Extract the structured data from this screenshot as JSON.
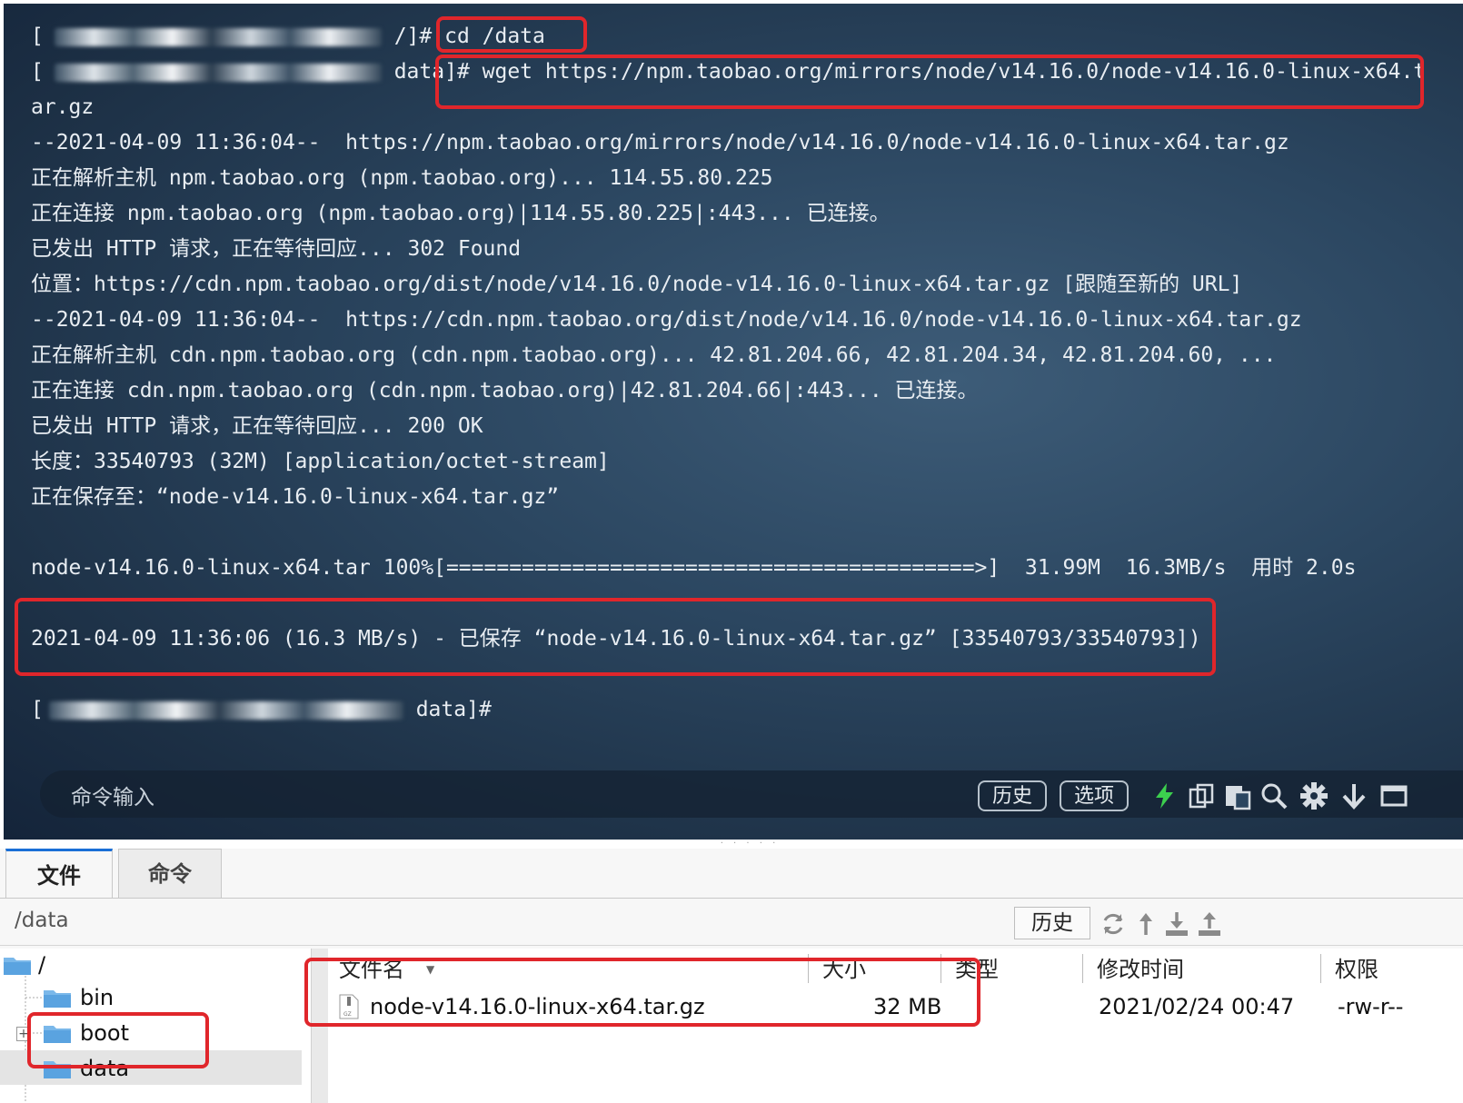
{
  "terminal": {
    "prompt1_suffix": " /]#",
    "cmd1": " cd /data",
    "prompt2_suffix": " data]#",
    "cmd2": " wget https://npm.taobao.org/mirrors/node/v14.16.0/node-v14.16.0-linux-x64.t",
    "lines": [
      "ar.gz",
      "--2021-04-09 11:36:04--  https://npm.taobao.org/mirrors/node/v14.16.0/node-v14.16.0-linux-x64.tar.gz",
      "正在解析主机 npm.taobao.org (npm.taobao.org)... 114.55.80.225",
      "正在连接 npm.taobao.org (npm.taobao.org)|114.55.80.225|:443... 已连接。",
      "已发出 HTTP 请求，正在等待回应... 302 Found",
      "位置：https://cdn.npm.taobao.org/dist/node/v14.16.0/node-v14.16.0-linux-x64.tar.gz [跟随至新的 URL]",
      "--2021-04-09 11:36:04--  https://cdn.npm.taobao.org/dist/node/v14.16.0/node-v14.16.0-linux-x64.tar.gz",
      "正在解析主机 cdn.npm.taobao.org (cdn.npm.taobao.org)... 42.81.204.66, 42.81.204.34, 42.81.204.60, ...",
      "正在连接 cdn.npm.taobao.org (cdn.npm.taobao.org)|42.81.204.66|:443... 已连接。",
      "已发出 HTTP 请求，正在等待回应... 200 OK",
      "长度：33540793 (32M) [application/octet-stream]",
      "正在保存至：“node-v14.16.0-linux-x64.tar.gz”",
      "",
      "node-v14.16.0-linux-x64.tar 100%[==========================================>]  31.99M  16.3MB/s  用时 2.0s",
      "",
      "2021-04-09 11:36:06 (16.3 MB/s) - 已保存 “node-v14.16.0-linux-x64.tar.gz” [33540793/33540793])"
    ],
    "prompt3_suffix": " data]#",
    "command_input_label": "命令输入",
    "history_button": "历史",
    "options_button": "选项",
    "icons": [
      "lightning-icon",
      "copy-icon",
      "paste-icon",
      "search-icon",
      "gear-icon",
      "download-arrow-icon",
      "maximize-icon"
    ]
  },
  "file_manager": {
    "tabs": [
      "文件",
      "命令"
    ],
    "current_path": "/data",
    "history_button": "历史",
    "tree": [
      {
        "label": "/"
      },
      {
        "label": "bin"
      },
      {
        "label": "boot"
      },
      {
        "label": "data"
      }
    ],
    "columns": [
      "文件名",
      "大小",
      "类型",
      "修改时间",
      "权限"
    ],
    "rows": [
      {
        "name": "node-v14.16.0-linux-x64.tar.gz",
        "size": "32 MB",
        "type": "",
        "modified": "2021/02/24 00:47",
        "permissions": "-rw-r--"
      }
    ]
  },
  "colors": {
    "highlight_box": "#e0262b",
    "terminal_bg": "#2b4660",
    "tab_accent": "#1a6fd6"
  }
}
